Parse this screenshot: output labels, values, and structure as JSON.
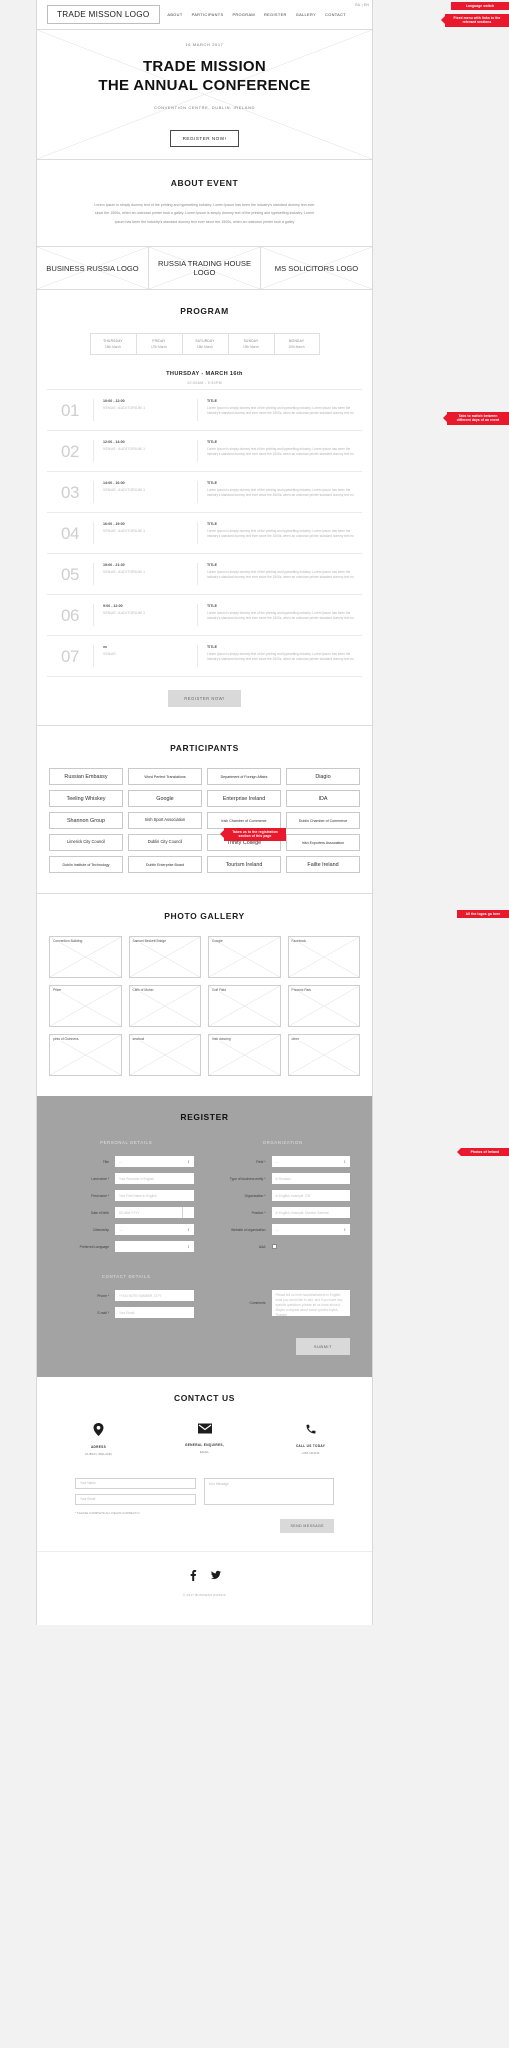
{
  "header": {
    "logo": "TRADE MISSON LOGO",
    "nav": [
      "ABOUT",
      "PARTICIPANTS",
      "PROGRAM",
      "REGISTER",
      "GALLERY",
      "CONTACT"
    ],
    "lang": "RU | EN"
  },
  "callouts": {
    "language": "Language switch",
    "menu": "Fixed menu with links to the relevant sections",
    "program_tabs": "Tabs to switch between different days of an event",
    "register_btn": "Takes us to the registration section of this page",
    "participants": "All the logos go here",
    "gallery": "Photos of Ireland"
  },
  "hero": {
    "date": "16 MARCH 2017",
    "title_line1": "TRADE MISSION",
    "title_line2": "THE ANNUAL CONFERENCE",
    "subtitle": "CONVENTION CENTRE, DUBLIN, IRELAND",
    "cta": "REGISTER NOW!"
  },
  "about": {
    "title": "ABOUT EVENT",
    "body": "Lorem Ipsum is simply dummy text of the printing and typesetting industry. Lorem Ipsum has been the industry's standard dummy text ever since the 1500s, when an unknown printer took a galley. Lorem Ipsum is simply dummy text of the printing and typesetting industry. Lorem Ipsum has been the industry's standard dummy text ever since the 1500s, when an unknown printer took a galley"
  },
  "logos": [
    "BUSINESS RUSSIA LOGO",
    "RUSSIA TRADING HOUSE LOGO",
    "MS SOLICITORS LOGO"
  ],
  "program": {
    "title": "PROGRAM",
    "days": [
      {
        "name": "THURSDAY",
        "date": "16th March"
      },
      {
        "name": "FRIDAY",
        "date": "17th March"
      },
      {
        "name": "SATURDAY",
        "date": "18th March"
      },
      {
        "name": "SUNDAY",
        "date": "19th March"
      },
      {
        "name": "MONDAY",
        "date": "20th March"
      }
    ],
    "day_heading": "THURSDAY - MARCH 16th",
    "day_hours": "10:00AM - 9:30PM",
    "desc": "Lorem Ipsum is simply dummy text of the printing and typesetting industry. Lorem Ipsum has been the industry's standard dummy text ever since the 1500s, when an unknown printer standard dummy text ev.",
    "item_title": "TITLE",
    "rows": [
      {
        "num": "01",
        "time": "10:00 - 12:00",
        "venue": "VENUE: AUDITORIUM 1"
      },
      {
        "num": "02",
        "time": "12:00 - 14:00",
        "venue": "VENUE: AUDITORIUM 1"
      },
      {
        "num": "03",
        "time": "14:00 - 16:00",
        "venue": "VENUE: AUDITORIUM 1"
      },
      {
        "num": "04",
        "time": "16:00 - 19:00",
        "venue": "VENUE: AUDITORIUM 1"
      },
      {
        "num": "05",
        "time": "19:00 - 21:30",
        "venue": "VENUE: AUDITORIUM 1"
      },
      {
        "num": "06",
        "time": "9:00 - 12:00",
        "venue": "VENUE: AUDITORIUM 1"
      },
      {
        "num": "07",
        "time": "xx",
        "venue": "VENUE:"
      }
    ],
    "cta": "REGISTER NOW!"
  },
  "participants": {
    "title": "PARTICIPANTS",
    "items": [
      {
        "label": "Russian Embassy",
        "size": "s1"
      },
      {
        "label": "Word Perfect Translations",
        "size": "s3"
      },
      {
        "label": "Department of Foreign Affairs",
        "size": "s3"
      },
      {
        "label": "Diagio",
        "size": "s1"
      },
      {
        "label": "Teeling Whiskey",
        "size": "s1"
      },
      {
        "label": "Google",
        "size": "s1"
      },
      {
        "label": "Enterprise Ireland",
        "size": "s1"
      },
      {
        "label": "IDA",
        "size": "s1"
      },
      {
        "label": "Shannon Group",
        "size": "s1"
      },
      {
        "label": "Irish Sport Association",
        "size": "s2"
      },
      {
        "label": "Irish Chamber of Commerce",
        "size": "s3"
      },
      {
        "label": "Dublin Chamber of Commerce",
        "size": "s3"
      },
      {
        "label": "Limerick City Council",
        "size": "s2"
      },
      {
        "label": "Dublin City Council",
        "size": "s2"
      },
      {
        "label": "Trinity College",
        "size": "s1"
      },
      {
        "label": "Irish Exporters Association",
        "size": "s3"
      },
      {
        "label": "Dublin Institute of Technology",
        "size": "s3"
      },
      {
        "label": "Dublin Enterprise Board",
        "size": "s3"
      },
      {
        "label": "Tourism Ireland",
        "size": "s1"
      },
      {
        "label": "Failte Ireland",
        "size": "s1"
      }
    ]
  },
  "gallery": {
    "title": "PHOTO GALLERY",
    "items": [
      "Convention Building",
      "Samuel Beckett Bridge",
      "Google",
      "Facebook",
      "Pfizer",
      "Cliffs of Moher",
      "Golf Field",
      "Phoenix Park",
      "pints of Guinness",
      "seafood",
      "Irish dancing",
      "other"
    ]
  },
  "register": {
    "title": "REGISTER",
    "personal_heading": "PERSONAL DETAILS",
    "organization_heading": "ORGANIZATION",
    "contact_heading": "CONTACT DETAILS",
    "personal": [
      {
        "label": "Title",
        "value": "---",
        "type": "select"
      },
      {
        "label": "Last name *",
        "value": "Your Surname in English",
        "type": "text"
      },
      {
        "label": "First name *",
        "value": "Your First Name in English",
        "type": "text"
      },
      {
        "label": "Date of birth",
        "value": "DD-MM-YYYY",
        "type": "date"
      },
      {
        "label": "Citizenship",
        "value": "---",
        "type": "select"
      },
      {
        "label": "Preferred Language",
        "value": "",
        "type": "select"
      }
    ],
    "organization": [
      {
        "label": "Field *",
        "value": "---",
        "type": "select"
      },
      {
        "label": "Type of business entity *",
        "value": "In Russian",
        "type": "text"
      },
      {
        "label": "Organization *",
        "value": "In English, example: ITB",
        "type": "text"
      },
      {
        "label": "Position *",
        "value": "In English, example: Director General",
        "type": "text"
      },
      {
        "label": "Website of organization",
        "value": "---",
        "type": "select"
      },
      {
        "label": "AAA",
        "value": "",
        "type": "checkbox"
      }
    ],
    "contact": [
      {
        "label": "Phone *",
        "value": "+YOU NOTE NUMBER, CITY",
        "type": "text"
      },
      {
        "label": "E-mail *",
        "value": "Your Email",
        "type": "text"
      }
    ],
    "comments_label": "Comments",
    "comments_value": "Please tell us here how/what/where in English what you would like to add, and if you have any specific questions, please let us know about it. Maybe a request about some specific topics. Thanks!",
    "submit": "SUBMIT"
  },
  "contact": {
    "title": "CONTACT US",
    "blocks": [
      {
        "icon": "pin-icon",
        "glyph": "⊙",
        "title": "ADRESS",
        "value": "DUBLIN, IRELAND"
      },
      {
        "icon": "envelope-icon",
        "glyph": "✉",
        "title": "GENERAL ENQUIRES,",
        "value": "EMAIL"
      },
      {
        "icon": "phone-icon",
        "glyph": "☎",
        "title": "CALL US TODAY",
        "value": "+353 1111111"
      }
    ],
    "name_placeholder": "Your Name",
    "email_placeholder": "Your Email",
    "message_placeholder": "Your Message",
    "note": "* PLEASE COMPLETE ALL FIELDS CORRECTLY",
    "send": "SEND MESSAGE"
  },
  "footer": {
    "socials": [
      {
        "name": "facebook-icon",
        "glyph": "f"
      },
      {
        "name": "twitter-icon",
        "glyph": "ᴠ"
      }
    ],
    "copyright": "© 2017 BUSINESS RUSSIA"
  }
}
